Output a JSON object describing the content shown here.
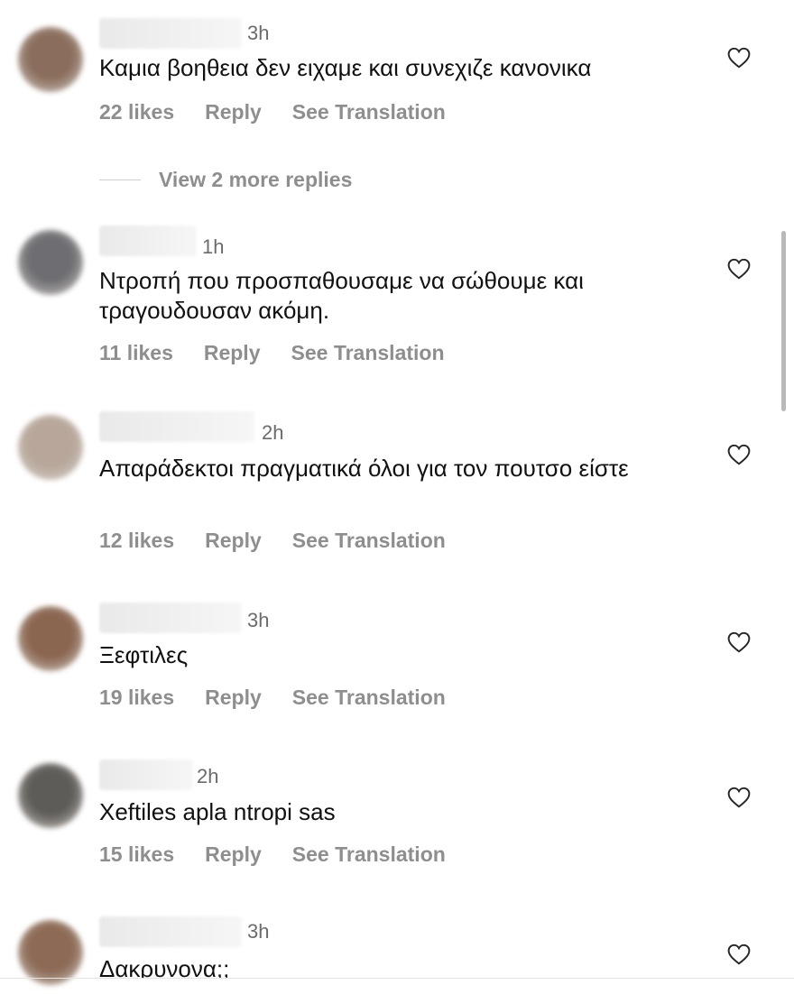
{
  "comments": [
    {
      "time": "3h",
      "text": "Καμια βοηθεια δεν ειχαμε και συνεχιζε κανονικα",
      "likes": "22 likes",
      "reply": "Reply",
      "translate": "See Translation",
      "avatar_color": "#8a6d5c"
    },
    {
      "time": "1h",
      "text": "Ντροπή που  προσπαθουσαμε να  σώθουμε και τραγουδουσαν ακόμη.",
      "likes": "11 likes",
      "reply": "Reply",
      "translate": "See Translation",
      "avatar_color": "#6e6e72"
    },
    {
      "time": "2h",
      "text": "Απαράδεκτοι πραγματικά όλοι για τον πουτσο είστε",
      "likes": "12 likes",
      "reply": "Reply",
      "translate": "See Translation",
      "avatar_color": "#b7a699"
    },
    {
      "time": "3h",
      "text": "Ξεφτιλες",
      "likes": "19 likes",
      "reply": "Reply",
      "translate": "See Translation",
      "avatar_color": "#8a6550"
    },
    {
      "time": "2h",
      "text": "Xeftiles apla ntropi sas",
      "likes": "15 likes",
      "reply": "Reply",
      "translate": "See Translation",
      "avatar_color": "#5e5c58"
    },
    {
      "time": "3h",
      "text": "Δακρυνονα;;",
      "likes": "",
      "reply": "",
      "translate": "",
      "avatar_color": "#8c6a55"
    }
  ],
  "view_more_replies": "View 2 more replies",
  "colors": {
    "text": "#111111",
    "muted": "#8e8e8e",
    "timestamp": "#6b6b6b"
  }
}
